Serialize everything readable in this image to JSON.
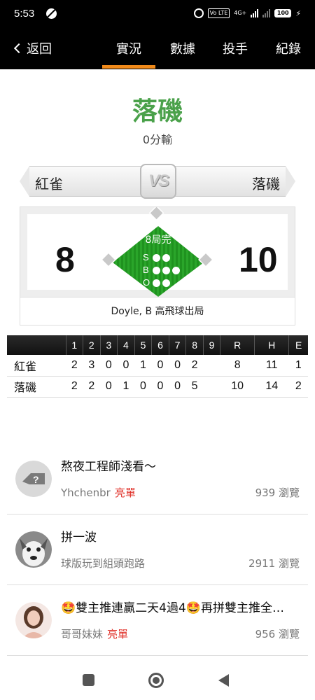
{
  "status_bar": {
    "time": "5:53",
    "network": "4G+",
    "volte": "Vo LTE",
    "battery": "100"
  },
  "nav": {
    "back_label": "返回",
    "tabs": [
      {
        "label": "實況",
        "active": true
      },
      {
        "label": "數據",
        "active": false
      },
      {
        "label": "投手",
        "active": false
      },
      {
        "label": "紀錄",
        "active": false
      }
    ],
    "accent_color": "#f08a1a"
  },
  "header": {
    "team_title": "落磯",
    "result": "0分輸",
    "title_color": "#4aa14a"
  },
  "matchup": {
    "away_team": "紅雀",
    "home_team": "落磯",
    "vs_label": "VS"
  },
  "scoreboard": {
    "away_score": "8",
    "home_score": "10",
    "inning": "8局完",
    "count_labels": {
      "strike": "S",
      "ball": "B",
      "out": "O"
    },
    "last_play": "Doyle, B 高飛球出局",
    "field_color": "#22a022"
  },
  "linescore": {
    "headers": [
      "",
      "1",
      "2",
      "3",
      "4",
      "5",
      "6",
      "7",
      "8",
      "9",
      "R",
      "H",
      "E"
    ],
    "rows": [
      {
        "team": "紅雀",
        "cells": [
          "2",
          "3",
          "0",
          "0",
          "1",
          "0",
          "0",
          "2",
          "",
          "8",
          "11",
          "1"
        ]
      },
      {
        "team": "落磯",
        "cells": [
          "2",
          "2",
          "0",
          "1",
          "0",
          "0",
          "0",
          "5",
          "",
          "10",
          "14",
          "2"
        ]
      }
    ]
  },
  "posts": [
    {
      "title": "熬夜工程師淺看～",
      "author": "Yhchenbr",
      "badge": "亮單",
      "views": "939 瀏覽",
      "avatar": "placeholder-avatar"
    },
    {
      "title": "拼一波",
      "author": "球版玩到組頭跑路",
      "badge": "",
      "views": "2911 瀏覽",
      "avatar": "husky-avatar"
    },
    {
      "title": "🤩雙主推連贏二天4過4🤩再拼雙主推全…",
      "author": "哥哥妹妹",
      "badge": "亮單",
      "views": "956 瀏覽",
      "avatar": "woman-avatar"
    }
  ],
  "system_nav": {
    "icons": [
      "recents-icon",
      "home-icon",
      "back-icon"
    ]
  }
}
